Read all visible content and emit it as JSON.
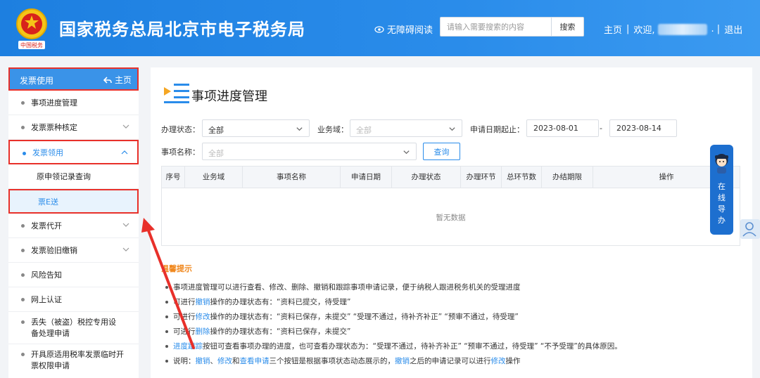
{
  "header": {
    "site_title": "国家税务总局北京市电子税务局",
    "accessibility": "无障碍阅读",
    "search_placeholder": "请输入需要搜索的内容",
    "search_button": "搜索",
    "nav_home": "主页",
    "nav_welcome": "欢迎,",
    "nav_logout": "退出",
    "separator": "|",
    "separator_end": ". |",
    "logo_text": "中国税务"
  },
  "sidebar": {
    "head_title": "发票使用",
    "head_home": "主页",
    "items": [
      {
        "label": "事项进度管理"
      },
      {
        "label": "发票票种核定"
      },
      {
        "label": "发票领用"
      },
      {
        "label": "原申领记录查询"
      },
      {
        "label": "票E送"
      },
      {
        "label": "发票代开"
      },
      {
        "label": "发票验旧缴销"
      },
      {
        "label": "风险告知"
      },
      {
        "label": "网上认证"
      },
      {
        "label": "丢失（被盗）税控专用设备处理申请"
      },
      {
        "label": "开具原适用税率发票临时开票权限申请"
      }
    ]
  },
  "main": {
    "page_title": "事项进度管理",
    "filters": {
      "status_label": "办理状态：",
      "status_value": "全部",
      "domain_label": "业务域：",
      "domain_value": "全部",
      "date_label": "申请日期起止：",
      "date_from": "2023-08-01",
      "date_sep": "-",
      "date_to": "2023-08-14",
      "name_label": "事项名称：",
      "name_value": "全部",
      "query_button": "查询"
    },
    "table": {
      "headers": [
        "序号",
        "业务域",
        "事项名称",
        "申请日期",
        "办理状态",
        "办理环节",
        "总环节数",
        "办结期限",
        "操作"
      ],
      "empty_text": "暂无数据"
    },
    "tips_title": "温馨提示",
    "tips": {
      "t1": "事项进度管理可以进行查看、修改、删除、撤销和跟踪事项申请记录，便于纳税人跟进税务机关的受理进度",
      "t2_a": "可进行",
      "t2_hl": "撤销",
      "t2_b": "操作的办理状态有：“资料已提交，待受理”",
      "t3_a": "可进行",
      "t3_hl": "修改",
      "t3_b": "操作的办理状态有：“资料已保存，未提交” “受理不通过，待补齐补正” “预审不通过，待受理”",
      "t4_a": "可进行",
      "t4_hl": "删除",
      "t4_b": "操作的办理状态有：“资料已保存，未提交”",
      "t5_hl": "进度跟踪",
      "t5_b": "按钮可查看事项办理的进度，也可查看办理状态为：“受理不通过，待补齐补正” “预审不通过，待受理” “不予受理”的具体原因。",
      "t6_a": "说明：",
      "t6_hl1": "撤销",
      "t6_s1": "、",
      "t6_hl2": "修改",
      "t6_s2": "和",
      "t6_hl3": "查看申请",
      "t6_b": "三个按钮是根据事项状态动态展示的，",
      "t6_hl4": "撤销",
      "t6_c": "之后的申请记录可以进行",
      "t6_hl5": "修改",
      "t6_d": "操作"
    }
  },
  "float_guide": "在线导办",
  "colors": {
    "header_blue": "#2a8cea",
    "highlight_red": "#e8302a",
    "tip_orange": "#f0871c"
  }
}
